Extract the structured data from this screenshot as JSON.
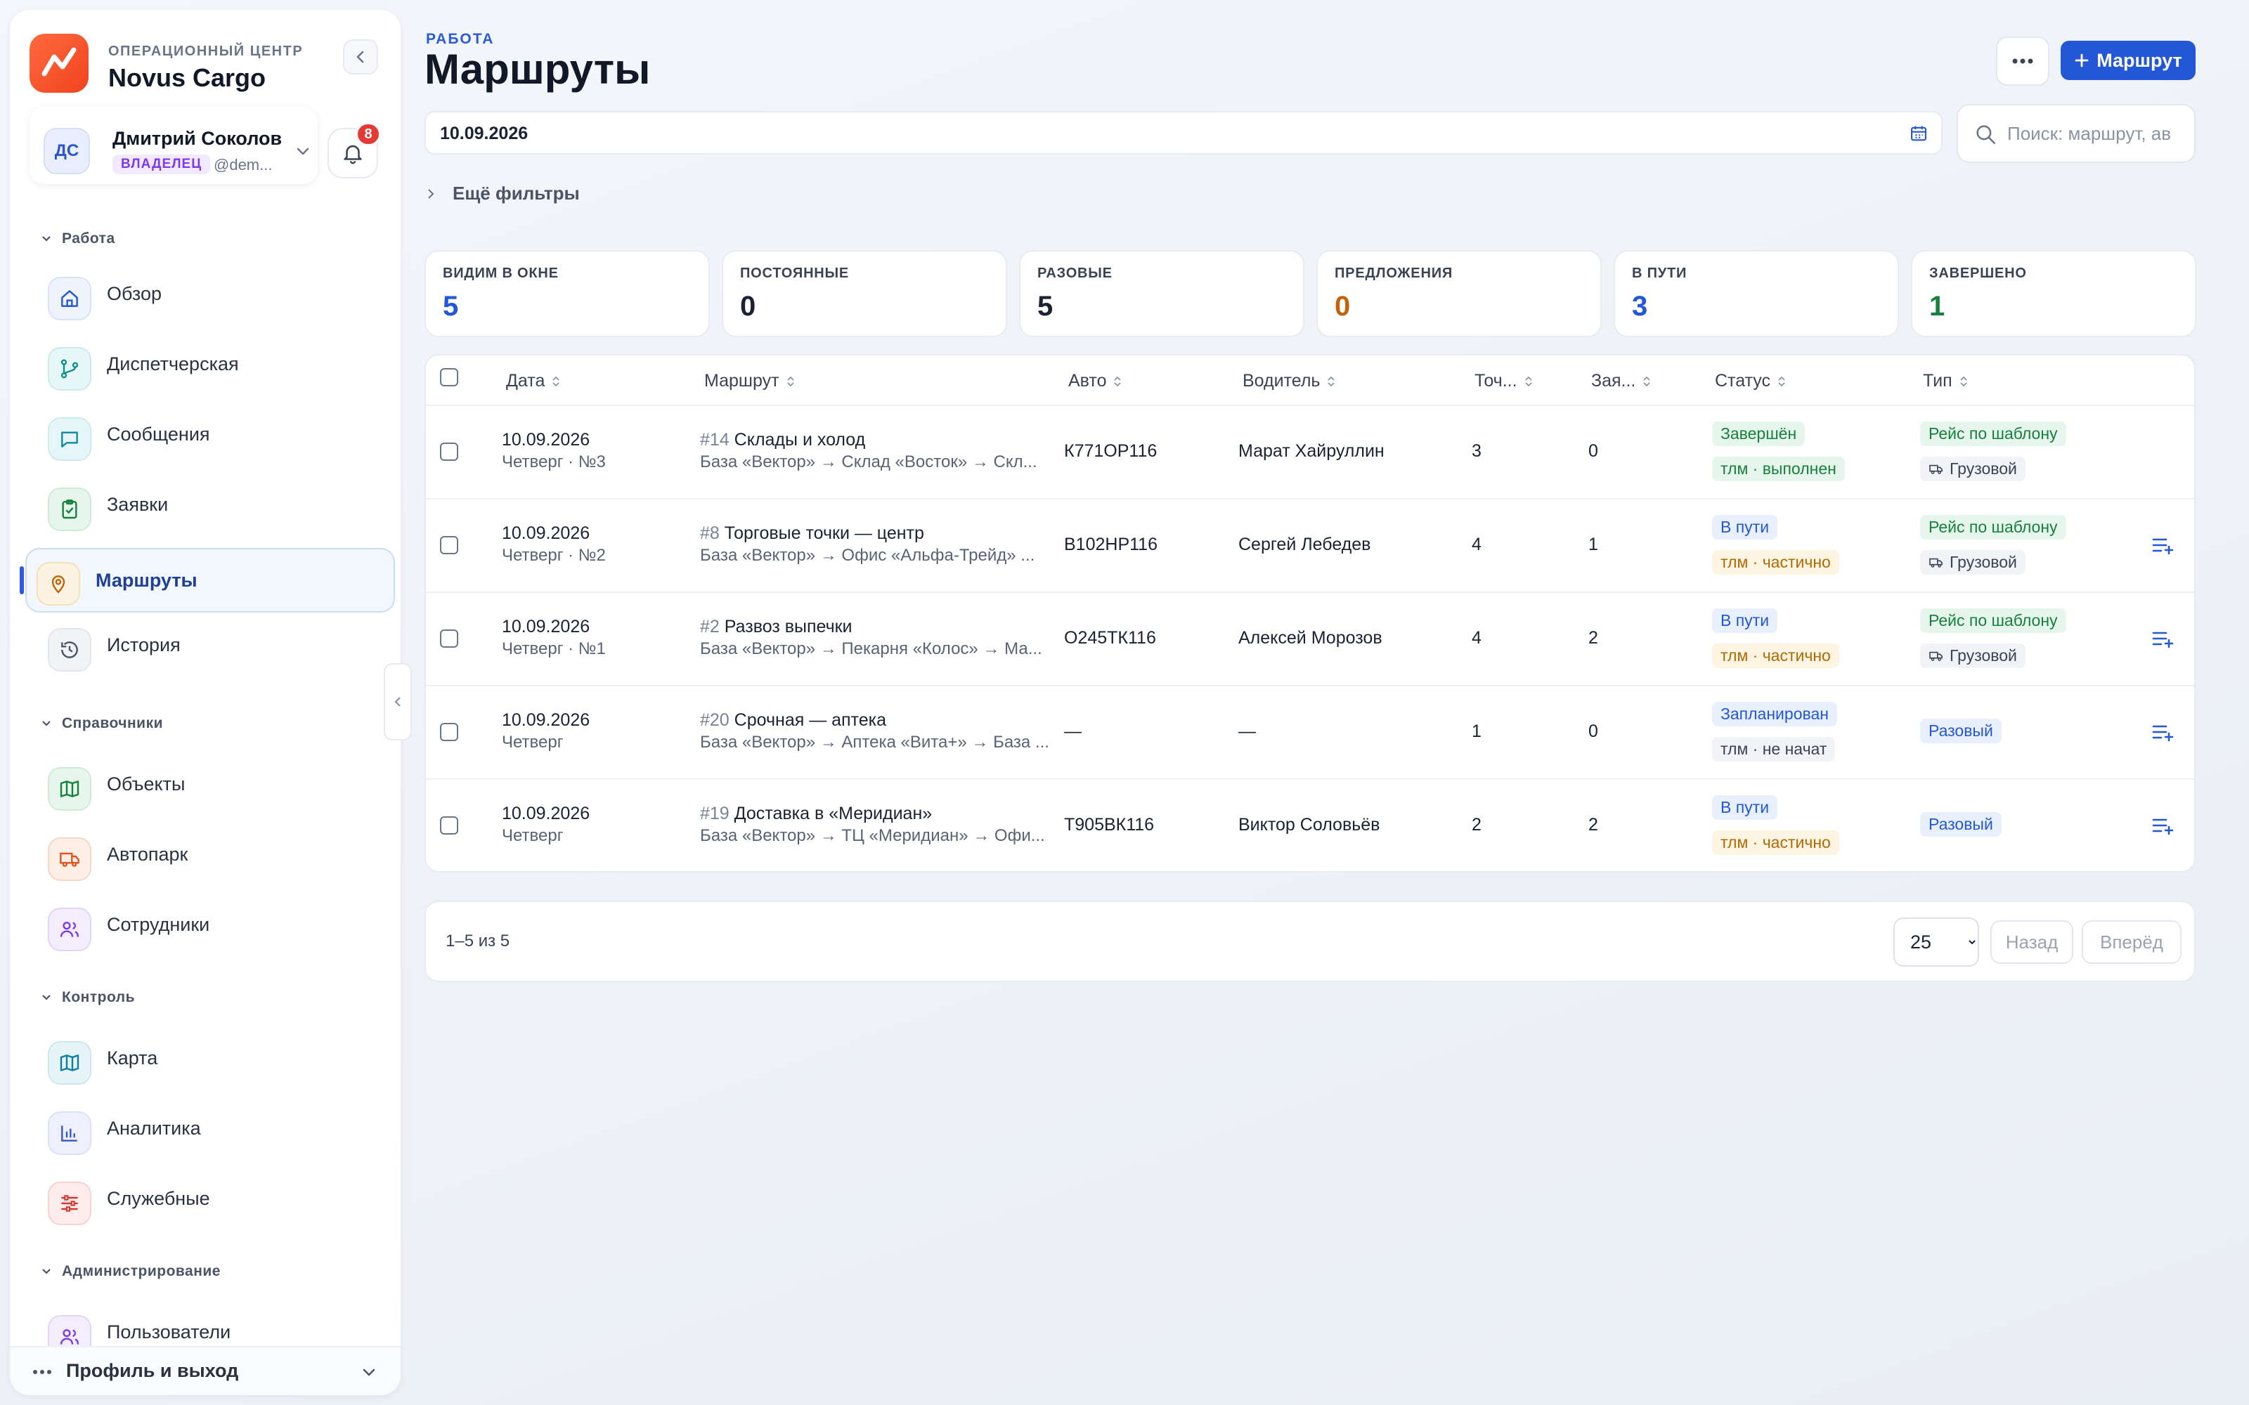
{
  "brand": {
    "subtitle": "ОПЕРАЦИОННЫЙ ЦЕНТР",
    "title": "Novus Cargo"
  },
  "user": {
    "initials": "ДС",
    "name": "Дмитрий Соколов",
    "role": "ВЛАДЕЛЕЦ",
    "handle": "@dem...",
    "notifications": "8"
  },
  "sidebar": {
    "sections": [
      {
        "title": "Работа",
        "items": [
          {
            "label": "Обзор",
            "icon": "home-icon"
          },
          {
            "label": "Диспетчерская",
            "icon": "git-branch-icon"
          },
          {
            "label": "Сообщения",
            "icon": "message-icon"
          },
          {
            "label": "Заявки",
            "icon": "clipboard-check-icon"
          },
          {
            "label": "Маршруты",
            "icon": "map-pin-icon",
            "active": true
          },
          {
            "label": "История",
            "icon": "history-icon"
          }
        ]
      },
      {
        "title": "Справочники",
        "items": [
          {
            "label": "Объекты",
            "icon": "map-icon"
          },
          {
            "label": "Автопарк",
            "icon": "truck-icon"
          },
          {
            "label": "Сотрудники",
            "icon": "users-icon"
          }
        ]
      },
      {
        "title": "Контроль",
        "items": [
          {
            "label": "Карта",
            "icon": "map-icon"
          },
          {
            "label": "Аналитика",
            "icon": "bar-chart-icon"
          },
          {
            "label": "Служебные",
            "icon": "sliders-icon"
          }
        ]
      },
      {
        "title": "Администрирование",
        "items": [
          {
            "label": "Пользователи",
            "icon": "users-icon"
          }
        ]
      }
    ],
    "footer": "Профиль и выход"
  },
  "header": {
    "eyebrow": "РАБОТА",
    "title": "Маршруты",
    "add_label": "Маршрут"
  },
  "filters": {
    "date": "10.09.2026",
    "search_placeholder": "Поиск: маршрут, ав",
    "more_filters": "Ещё фильтры"
  },
  "stats": [
    {
      "label": "ВИДИМ В ОКНЕ",
      "value": "5",
      "color": "#2457d6"
    },
    {
      "label": "ПОСТОЯННЫЕ",
      "value": "0",
      "color": "#1a2233"
    },
    {
      "label": "РАЗОВЫЕ",
      "value": "5",
      "color": "#1a2233"
    },
    {
      "label": "ПРЕДЛОЖЕНИЯ",
      "value": "0",
      "color": "#c2620a"
    },
    {
      "label": "В ПУТИ",
      "value": "3",
      "color": "#2457d6"
    },
    {
      "label": "ЗАВЕРШЕНО",
      "value": "1",
      "color": "#16803c"
    }
  ],
  "table": {
    "columns": [
      "Дата",
      "Маршрут",
      "Авто",
      "Водитель",
      "Точ...",
      "Зая...",
      "Статус",
      "Тип"
    ],
    "rows": [
      {
        "date": "10.09.2026",
        "day": "Четверг · №3",
        "num": "#14",
        "name": "Склады и холод",
        "path": "База «Вектор» → Склад «Восток» → Скл...",
        "car": "К771ОР116",
        "driver": "Марат Хайруллин",
        "points": "3",
        "orders": "0",
        "status": "Завершён",
        "status_color": "green",
        "tlm": "тлм · выполнен",
        "tlm_color": "green",
        "type": "Рейс по шаблону",
        "type_color": "green",
        "cargo": "Грузовой",
        "action": false
      },
      {
        "date": "10.09.2026",
        "day": "Четверг · №2",
        "num": "#8",
        "name": "Торговые точки — центр",
        "path": "База «Вектор» → Офис «Альфа-Трейд» ...",
        "car": "В102НР116",
        "driver": "Сергей Лебедев",
        "points": "4",
        "orders": "1",
        "status": "В пути",
        "status_color": "blue",
        "tlm": "тлм · частично",
        "tlm_color": "amber",
        "type": "Рейс по шаблону",
        "type_color": "green",
        "cargo": "Грузовой",
        "action": true
      },
      {
        "date": "10.09.2026",
        "day": "Четверг · №1",
        "num": "#2",
        "name": "Развоз выпечки",
        "path": "База «Вектор» → Пекарня «Колос» → Ма...",
        "car": "О245ТК116",
        "driver": "Алексей Морозов",
        "points": "4",
        "orders": "2",
        "status": "В пути",
        "status_color": "blue",
        "tlm": "тлм · частично",
        "tlm_color": "amber",
        "type": "Рейс по шаблону",
        "type_color": "green",
        "cargo": "Грузовой",
        "action": true
      },
      {
        "date": "10.09.2026",
        "day": "Четверг",
        "num": "#20",
        "name": "Срочная — аптека",
        "path": "База «Вектор» → Аптека «Вита+» → База ...",
        "car": "—",
        "driver": "—",
        "points": "1",
        "orders": "0",
        "status": "Запланирован",
        "status_color": "blue",
        "tlm": "тлм · не начат",
        "tlm_color": "gray",
        "type": "Разовый",
        "type_color": "blue",
        "cargo": "",
        "action": true
      },
      {
        "date": "10.09.2026",
        "day": "Четверг",
        "num": "#19",
        "name": "Доставка в «Меридиан»",
        "path": "База «Вектор» → ТЦ «Меридиан» → Офи...",
        "car": "Т905ВК116",
        "driver": "Виктор Соловьёв",
        "points": "2",
        "orders": "2",
        "status": "В пути",
        "status_color": "blue",
        "tlm": "тлм · частично",
        "tlm_color": "amber",
        "type": "Разовый",
        "type_color": "blue",
        "cargo": "",
        "action": true
      }
    ]
  },
  "pagination": {
    "summary": "1–5 из 5",
    "page_size": "25",
    "prev": "Назад",
    "next": "Вперёд"
  }
}
